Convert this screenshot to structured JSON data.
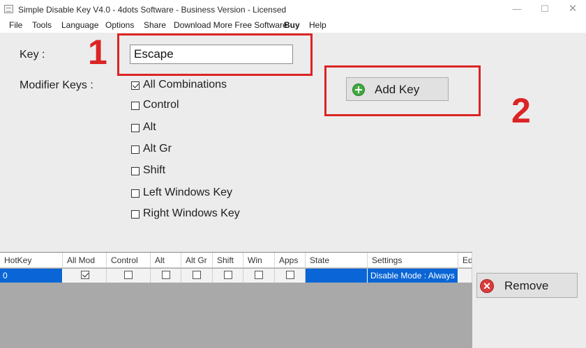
{
  "window": {
    "title": "Simple Disable Key V4.0 - 4dots Software - Business Version - Licensed",
    "min_glyph": "—",
    "max_glyph": "☐",
    "close_glyph": "✕"
  },
  "menu": [
    "File",
    "Tools",
    "Language",
    "Options",
    "Share",
    "Download More Free Software",
    "Buy",
    "Help"
  ],
  "form": {
    "key_label": "Key :",
    "key_value": "Escape",
    "modifier_label": "Modifier Keys :",
    "modifiers": [
      {
        "label": "All Combinations",
        "checked": true
      },
      {
        "label": "Control",
        "checked": false
      },
      {
        "label": "Alt",
        "checked": false
      },
      {
        "label": "Alt Gr",
        "checked": false
      },
      {
        "label": "Shift",
        "checked": false
      },
      {
        "label": "Left Windows Key",
        "checked": false
      },
      {
        "label": "Right Windows Key",
        "checked": false
      }
    ]
  },
  "buttons": {
    "add_key": "Add Key",
    "remove": "Remove",
    "remove_glyph": "✕"
  },
  "annotations": {
    "step1": "1",
    "step2": "2",
    "color": "#dc2424"
  },
  "grid": {
    "columns": [
      "HotKey",
      "All Mod",
      "Control",
      "Alt",
      "Alt Gr",
      "Shift",
      "Win",
      "Apps",
      "State",
      "Settings",
      "Ed"
    ],
    "rows": [
      {
        "hotkey": "0",
        "all_mod": true,
        "control": false,
        "alt": false,
        "alt_gr": false,
        "shift": false,
        "win": false,
        "apps": false,
        "state": "",
        "settings": "Disable Mode : Always",
        "ed": ""
      }
    ],
    "selection_color": "#0a66d6"
  },
  "icons": {
    "app": "keyboard-icon",
    "add": "plus-circle-icon",
    "remove": "x-circle-icon"
  }
}
